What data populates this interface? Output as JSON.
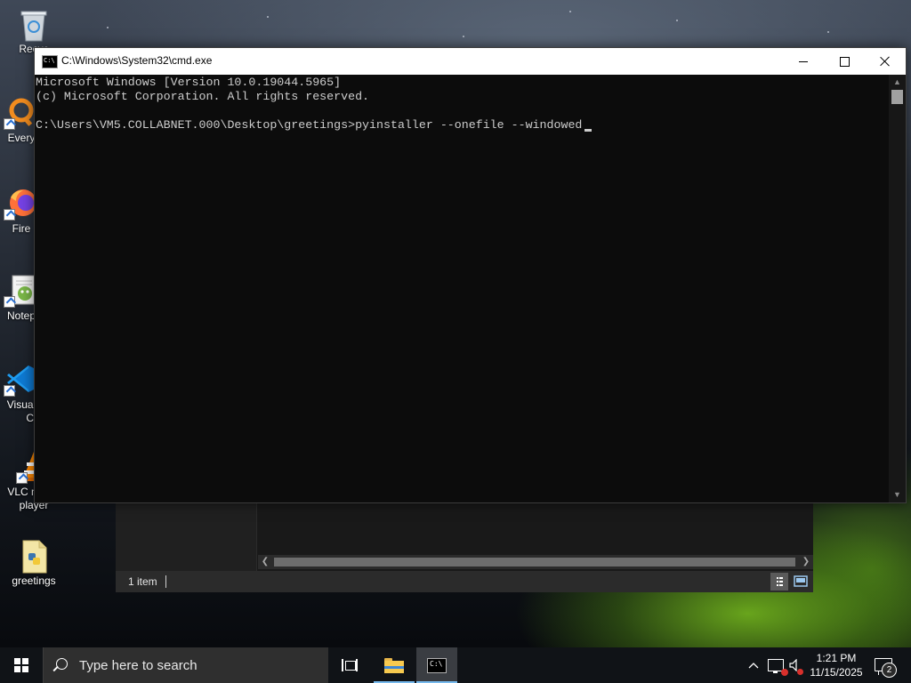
{
  "desktop": {
    "icons": [
      {
        "label": "Recyc"
      },
      {
        "label": "Every"
      },
      {
        "label": "Fire"
      },
      {
        "label": "Notep"
      },
      {
        "label": "Visual",
        "label2": "Co"
      },
      {
        "label": "VLC media",
        "label2": "player"
      },
      {
        "label": "greetings"
      }
    ]
  },
  "cmd": {
    "title": "C:\\Windows\\System32\\cmd.exe",
    "app_icon_text": "C:\\",
    "lines": [
      "Microsoft Windows [Version 10.0.19044.5965]",
      "(c) Microsoft Corporation. All rights reserved.",
      "",
      "C:\\Users\\VM5.COLLABNET.000\\Desktop\\greetings>pyinstaller --onefile --windowed"
    ]
  },
  "explorer": {
    "status_count": "1 item"
  },
  "taskbar": {
    "search_placeholder": "Type here to search",
    "pinned": [
      "file-explorer",
      "command-prompt"
    ],
    "active": "command-prompt"
  },
  "tray": {
    "time": "1:21 PM",
    "date": "11/15/2025",
    "notification_count": "2",
    "network_status": "disconnected",
    "volume_status": "muted"
  },
  "colors": {
    "console_bg": "#0c0c0c",
    "console_text": "#cccccc",
    "taskbar_bg": "#101317",
    "accent": "#76b9ed"
  }
}
